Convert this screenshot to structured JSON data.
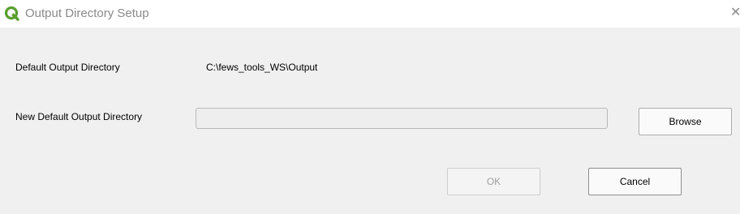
{
  "window": {
    "title": "Output Directory Setup",
    "close_glyph": "✕",
    "app_icon": "qgis-logo-icon"
  },
  "form": {
    "default_dir_label": "Default Output Directory",
    "default_dir_value": "C:\\fews_tools_WS\\Output",
    "new_dir_label": "New Default Output Directory",
    "new_dir_value": "",
    "browse_label": "Browse"
  },
  "buttons": {
    "ok_label": "OK",
    "cancel_label": "Cancel"
  },
  "colors": {
    "brand_green": "#5a9e2f",
    "title_text": "#8a8a8a",
    "background": "#f0f0f0"
  }
}
